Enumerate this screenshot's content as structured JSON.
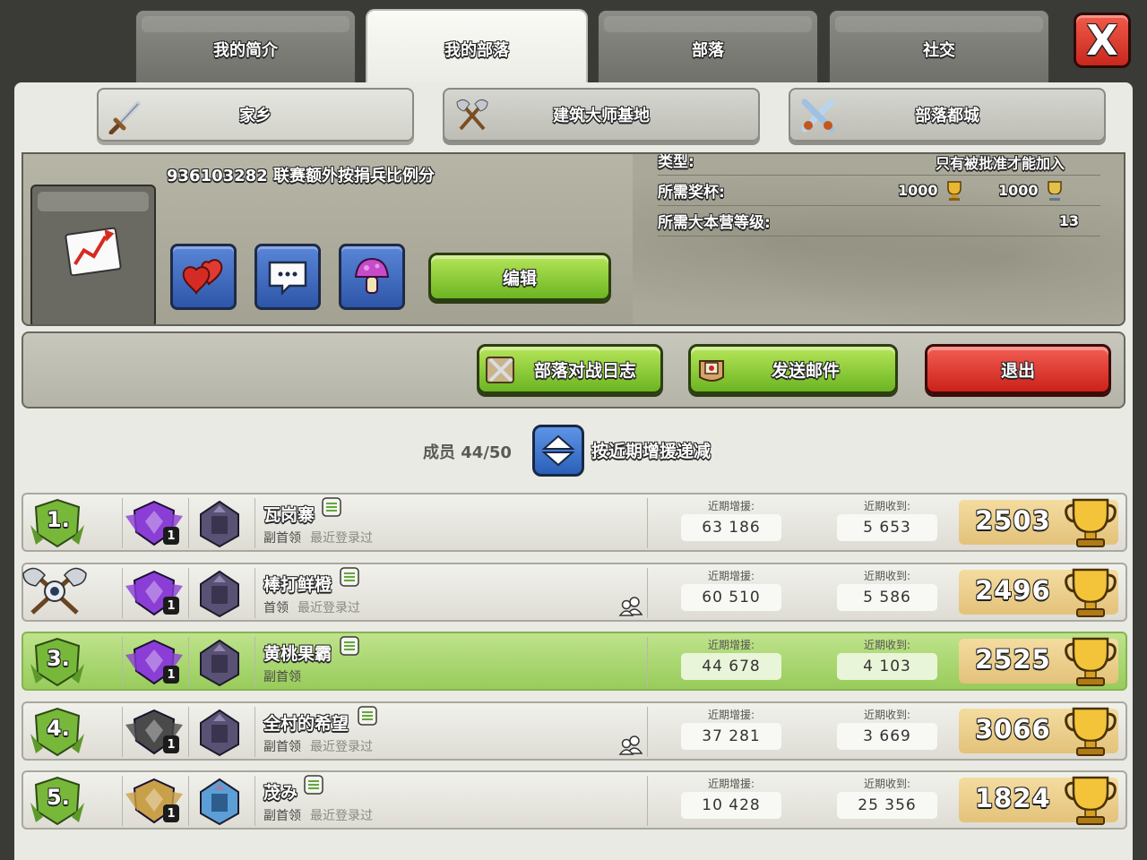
{
  "tabs": [
    {
      "label": "我的简介",
      "active": false
    },
    {
      "label": "我的部落",
      "active": true
    },
    {
      "label": "部落",
      "active": false
    },
    {
      "label": "社交",
      "active": false
    }
  ],
  "close_label": "X",
  "subtabs": [
    {
      "label": "家乡",
      "icon": "sword-icon",
      "active": true
    },
    {
      "label": "建筑大师基地",
      "icon": "crossed-axes-icon",
      "active": false
    },
    {
      "label": "部落都城",
      "icon": "crossed-swords-icon",
      "active": false
    }
  ],
  "clan_info": {
    "description": "936103282 联赛额外按捐兵比例分",
    "edit_label": "编辑",
    "requirements": [
      {
        "label": "类型:",
        "value": "只有被批准才能加入"
      },
      {
        "label": "所需奖杯:",
        "value1": "1000",
        "value2": "1000"
      },
      {
        "label": "所需大本营等级:",
        "value": "13"
      }
    ]
  },
  "actions": {
    "war_log": "部落对战日志",
    "send_mail": "发送邮件",
    "leave": "退出"
  },
  "members_label": "成员 44/50",
  "sort_label": "按近期增援递减",
  "stat_labels": {
    "donated": "近期增援:",
    "received": "近期收到:"
  },
  "members": [
    {
      "rank": "1.",
      "name": "瓦岗寨",
      "role": "副首领",
      "last_seen": "最近登录过",
      "donated": "63 186",
      "received": "5 653",
      "trophies": "2503",
      "league_level": "1",
      "friend": false,
      "highlight": false,
      "rank_style": "badge"
    },
    {
      "rank": "",
      "name": "棒打鲜橙",
      "role": "首领",
      "last_seen": "最近登录过",
      "donated": "60 510",
      "received": "5 586",
      "trophies": "2496",
      "league_level": "1",
      "friend": true,
      "highlight": false,
      "rank_style": "axes"
    },
    {
      "rank": "3.",
      "name": "黄桃果霸",
      "role": "副首领",
      "last_seen": "",
      "donated": "44 678",
      "received": "4 103",
      "trophies": "2525",
      "league_level": "1",
      "friend": false,
      "highlight": true,
      "rank_style": "badge"
    },
    {
      "rank": "4.",
      "name": "全村的希望",
      "role": "副首领",
      "last_seen": "最近登录过",
      "donated": "37 281",
      "received": "3 669",
      "trophies": "3066",
      "league_level": "1",
      "friend": true,
      "highlight": false,
      "rank_style": "badge"
    },
    {
      "rank": "5.",
      "name": "茂み",
      "role": "副首领",
      "last_seen": "最近登录过",
      "donated": "10 428",
      "received": "25 356",
      "trophies": "1824",
      "league_level": "1",
      "friend": false,
      "highlight": false,
      "rank_style": "badge"
    }
  ],
  "colors": {
    "accent_green": "#8cc83c",
    "accent_red": "#d62b20",
    "accent_blue": "#2f5eb6"
  }
}
